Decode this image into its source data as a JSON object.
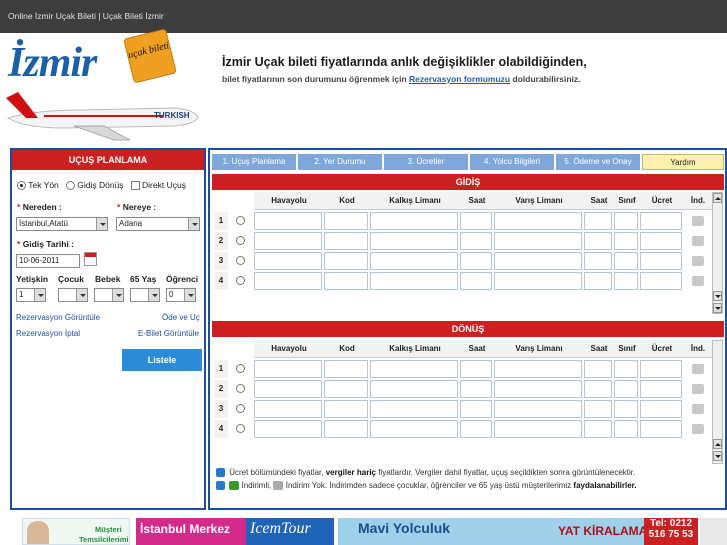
{
  "topbar": {
    "breadcrumb": "Online İzmir Uçak Bileti | Uçak Bileti İzmir"
  },
  "logo": {
    "text": "İzmir",
    "tag": "uçak bileti",
    "airline": "TURKISH"
  },
  "header": {
    "headline": "İzmir Uçak bileti fiyatlarında anlık değişiklikler olabildiğinden,",
    "subline_pre": "bilet fiyatlarının son durumunu öğrenmek için",
    "subline_link": "Rezervasyon formumuzu",
    "subline_post": "doldurabilirsiniz."
  },
  "planner": {
    "title": "UÇUŞ PLANLAMA",
    "trip_one_way": "Tek Yön",
    "trip_round": "Gidiş Dönüş",
    "direct": "Direkt Uçuş",
    "from_label": "Nereden :",
    "from_value": "İstanbul,Atatü",
    "to_label": "Nereye :",
    "to_value": "Adana",
    "date_label": "Gidiş Tarihi :",
    "date_value": "10-06-2011",
    "pax_labels": [
      "Yetişkin",
      "Çocuk",
      "Bebek",
      "65 Yaş",
      "Öğrenci"
    ],
    "pax_values": [
      "1",
      "",
      "",
      "",
      "0"
    ],
    "link_view": "Rezervasyon Görüntüle",
    "link_pay": "Öde ve Uç",
    "link_cancel": "Rezervasyon İptal",
    "link_eticket": "E-Bilet Görüntüle",
    "list_button": "Listele"
  },
  "steps": [
    "1. Uçuş Planlama",
    "2. Yer Durumu",
    "3. Ücretler",
    "4. Yolcu Bilgileri",
    "5. Ödeme ve Onay",
    "Yardım"
  ],
  "outbound": {
    "title": "GİDİŞ",
    "columns": [
      "Havayolu",
      "Kod",
      "Kalkış Limanı",
      "Saat",
      "Varış Limanı",
      "Saat",
      "Sınıf",
      "Ücret",
      "İnd."
    ],
    "rows": [
      "1",
      "2",
      "3",
      "4"
    ]
  },
  "return": {
    "title": "DÖNÜŞ",
    "columns": [
      "Havayolu",
      "Kod",
      "Kalkış Limanı",
      "Saat",
      "Varış Limanı",
      "Saat",
      "Sınıf",
      "Ücret",
      "İnd."
    ],
    "rows": [
      "1",
      "2",
      "3",
      "4"
    ]
  },
  "notes": {
    "line1_pre": "Ücret bölümündeki fiyatlar,",
    "line1_bold": "vergiler hariç",
    "line1_post": "fiyatlardır. Vergiler dahil fiyatlar, uçuş seçildikten sonra görüntülenecektir.",
    "line2_a": "İndirimli,",
    "line2_b": "İndirim Yok. İndirimden sadece çocuklar, öğrenciler ve 65 yaş üstü müşterilerimiz",
    "line2_bold": "faydalanabilirler."
  },
  "banners": {
    "b1_line1": "Müşteri",
    "b1_line2": "Temsilcilerimiz",
    "b2_a": "İstanbul Merkez",
    "b2_b": "IcemTour",
    "b3_a": "Mavi Yolculuk",
    "b3_b": "YAT KİRALAMA",
    "b3_tel": "Tel: 0212",
    "b3_num": "516 75 53"
  },
  "colors": {
    "brand_red": "#cc1f1f",
    "brand_blue": "#1a4fa0",
    "button_blue": "#2b8bd8"
  }
}
